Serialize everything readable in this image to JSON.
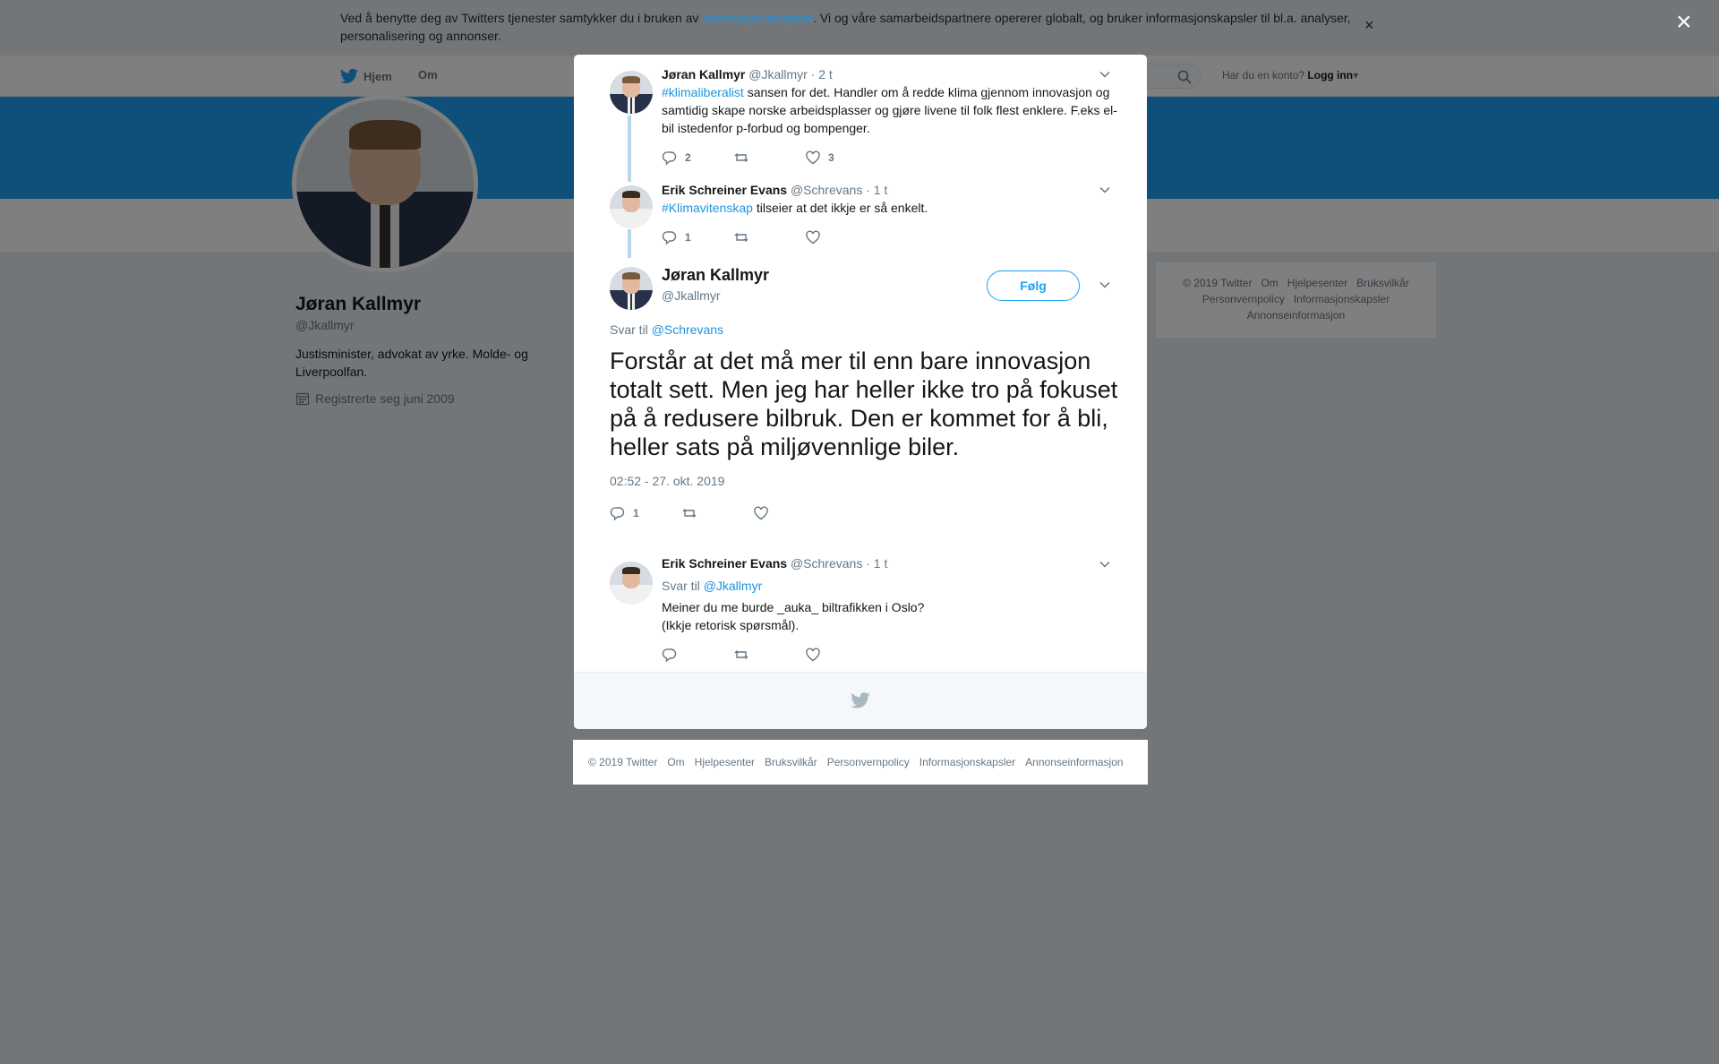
{
  "cookie_bar": {
    "text_before": "Ved å benytte deg av Twitters tjenester samtykker du i bruken av ",
    "link": "informasjonskapsler",
    "text_after": ". Vi og våre samarbeidspartnere opererer globalt, og bruker informasjonskapsler til bl.a. analyser, personalisering og annonser.",
    "close": "×"
  },
  "overlay_close": "×",
  "nav": {
    "home": "Hjem",
    "about": "Om",
    "login_prompt": "Har du en konto?",
    "login": "Logg inn"
  },
  "profile": {
    "name": "Jøran Kallmyr",
    "handle": "@Jkallmyr",
    "bio": "Justisminister, advokat av yrke. Molde- og Liverpoolfan.",
    "joined": "Registrerte seg juni 2009"
  },
  "side_footer": {
    "line1": [
      "© 2019 Twitter",
      "Om",
      "Hjelpesenter",
      "Bruksvilkår"
    ],
    "line2": [
      "Personvernpolicy",
      "Informasjonskapsler"
    ],
    "line3": [
      "Annonseinformasjon"
    ]
  },
  "thread": [
    {
      "name": "Jøran Kallmyr",
      "handle": "@Jkallmyr",
      "time": "· 2 t",
      "hashtag": "#klimaliberalist",
      "text": " sansen for det. Handler om å redde klima gjennom innovasjon og samtidig skape norske arbeidsplasser og gjøre livene til folk flest enklere. F.eks el-bil istedenfor p-forbud og bompenger.",
      "replies": "2",
      "retweets": "",
      "likes": "3"
    },
    {
      "name": "Erik Schreiner Evans",
      "handle": "@Schrevans",
      "time": "· 1 t",
      "hashtag": "#Klimavitenskap",
      "text": " tilseier at det ikkje er så enkelt.",
      "replies": "1",
      "retweets": "",
      "likes": ""
    }
  ],
  "main_tweet": {
    "name": "Jøran Kallmyr",
    "handle": "@Jkallmyr",
    "follow": "Følg",
    "reply_label": "Svar til ",
    "reply_to": "@Schrevans",
    "text": "Forstår at det må mer til enn bare innovasjon totalt sett. Men jeg har heller ikke tro på fokuset på å redusere bilbruk. Den er kommet for å bli, heller sats på miljøvennlige biler.",
    "timestamp": "02:52 - 27. okt. 2019",
    "replies": "1",
    "retweets": "",
    "likes": ""
  },
  "reply": {
    "name": "Erik Schreiner Evans",
    "handle": "@Schrevans",
    "time": "· 1 t",
    "reply_label": "Svar til ",
    "reply_to": "@Jkallmyr",
    "line1": "Meiner du me burde _auka_ biltrafikken i Oslo?",
    "line2": "(Ikkje retorisk spørsmål).",
    "replies": "",
    "retweets": "",
    "likes": ""
  },
  "page_footer": [
    "© 2019 Twitter",
    "Om",
    "Hjelpesenter",
    "Bruksvilkår",
    "Personvernpolicy",
    "Informasjonskapsler",
    "Annonseinformasjon"
  ],
  "colors": {
    "accent": "#1da1f2",
    "link": "#1b95e0",
    "muted": "#657786",
    "thread_line": "#b7d9ec"
  },
  "icons": {
    "reply": "reply-icon",
    "retweet": "retweet-icon",
    "like": "heart-icon",
    "chevron": "chevron-down-icon",
    "search": "search-icon",
    "calendar": "calendar-icon",
    "bird": "twitter-bird-icon"
  }
}
